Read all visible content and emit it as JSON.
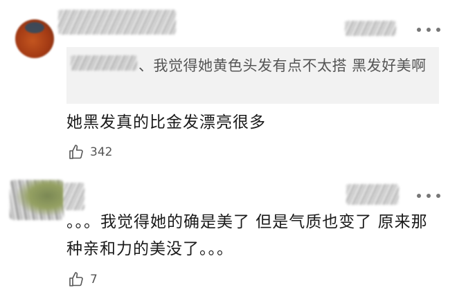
{
  "comments": [
    {
      "quote_text": "、我觉得她黄色头发有点不太搭 黑发好美啊",
      "body": "她黑发真的比金发漂亮很多",
      "likes": "342"
    },
    {
      "body": "。。。我觉得她的确是美了 但是气质也变了 原来那种亲和力的美没了。。。",
      "likes": "7"
    }
  ]
}
